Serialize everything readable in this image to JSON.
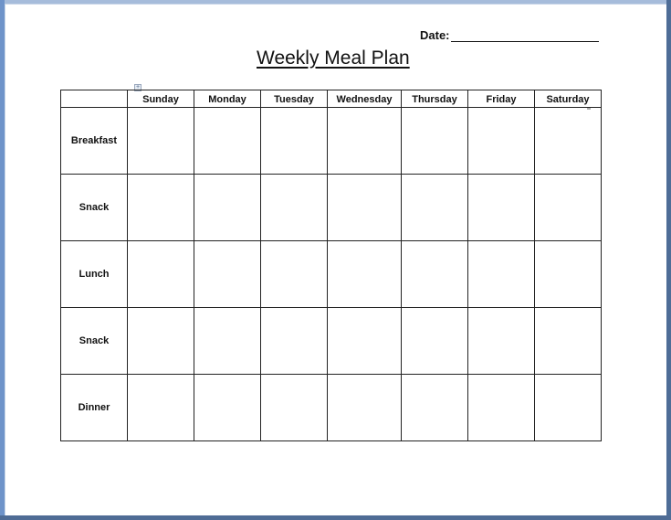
{
  "document": {
    "date_label": "Date:",
    "date_value": "",
    "title": "Weekly Meal Plan"
  },
  "table": {
    "corner_header": "",
    "days": [
      "Sunday",
      "Monday",
      "Tuesday",
      "Wednesday",
      "Thursday",
      "Friday",
      "Saturday"
    ],
    "meals": [
      "Breakfast",
      "Snack",
      "Lunch",
      "Snack",
      "Dinner"
    ],
    "cells": [
      [
        "",
        "",
        "",
        "",
        "",
        "",
        ""
      ],
      [
        "",
        "",
        "",
        "",
        "",
        "",
        ""
      ],
      [
        "",
        "",
        "",
        "",
        "",
        "",
        ""
      ],
      [
        "",
        "",
        "",
        "",
        "",
        "",
        ""
      ],
      [
        "",
        "",
        "",
        "",
        "",
        "",
        ""
      ]
    ]
  },
  "icons": {
    "table_move_handle": "move-arrows-icon",
    "table_resize_handle": "resize-handle-icon"
  },
  "colors": {
    "window_frame": "#6e93c9",
    "page_background": "#ffffff",
    "grid_lines": "#222222"
  }
}
